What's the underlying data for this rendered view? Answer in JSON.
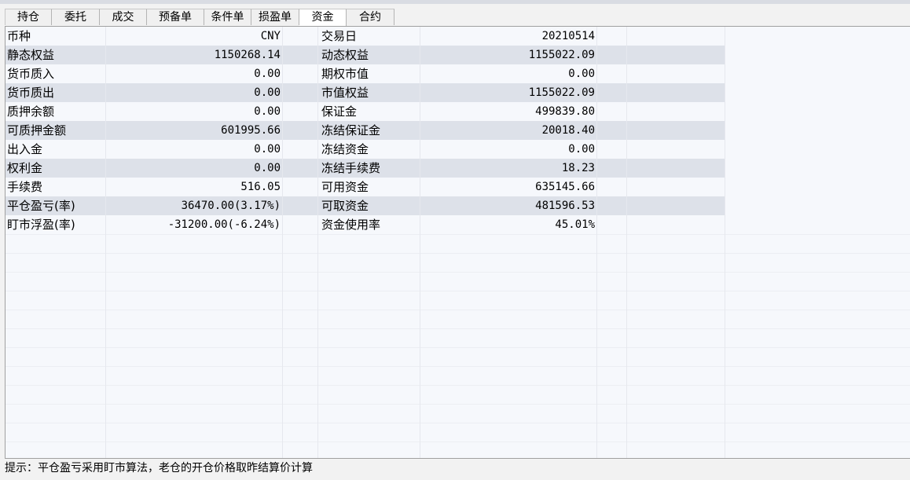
{
  "tabs": [
    {
      "label": "持仓",
      "active": false
    },
    {
      "label": "委托",
      "active": false
    },
    {
      "label": "成交",
      "active": false
    },
    {
      "label": "预备单",
      "active": false
    },
    {
      "label": "条件单",
      "active": false
    },
    {
      "label": "损盈单",
      "active": false
    },
    {
      "label": "资金",
      "active": true
    },
    {
      "label": "合约",
      "active": false
    }
  ],
  "fund_rows": [
    {
      "label1": "币种",
      "value1": "CNY",
      "label2": "交易日",
      "value2": "20210514"
    },
    {
      "label1": "静态权益",
      "value1": "1150268.14",
      "label2": "动态权益",
      "value2": "1155022.09"
    },
    {
      "label1": "货币质入",
      "value1": "0.00",
      "label2": "期权市值",
      "value2": "0.00"
    },
    {
      "label1": "货币质出",
      "value1": "0.00",
      "label2": "市值权益",
      "value2": "1155022.09"
    },
    {
      "label1": "质押余额",
      "value1": "0.00",
      "label2": "保证金",
      "value2": "499839.80"
    },
    {
      "label1": "可质押金额",
      "value1": "601995.66",
      "label2": "冻结保证金",
      "value2": "20018.40"
    },
    {
      "label1": "出入金",
      "value1": "0.00",
      "label2": "冻结资金",
      "value2": "0.00"
    },
    {
      "label1": "权利金",
      "value1": "0.00",
      "label2": "冻结手续费",
      "value2": "18.23"
    },
    {
      "label1": "手续费",
      "value1": "516.05",
      "label2": "可用资金",
      "value2": "635145.66"
    },
    {
      "label1": "平仓盈亏(率)",
      "value1": "36470.00(3.17%)",
      "label2": "可取资金",
      "value2": "481596.53"
    },
    {
      "label1": "盯市浮盈(率)",
      "value1": "-31200.00(-6.24%)",
      "label2": "资金使用率",
      "value2": "45.01%"
    }
  ],
  "status": {
    "tip": "提示：平仓盈亏采用盯市算法，老仓的开仓价格取昨结算价计算"
  },
  "colors": {
    "row_alt": "#dde1e9",
    "grid_bg": "#f6f8fc",
    "window_bg": "#f2f2f2"
  }
}
